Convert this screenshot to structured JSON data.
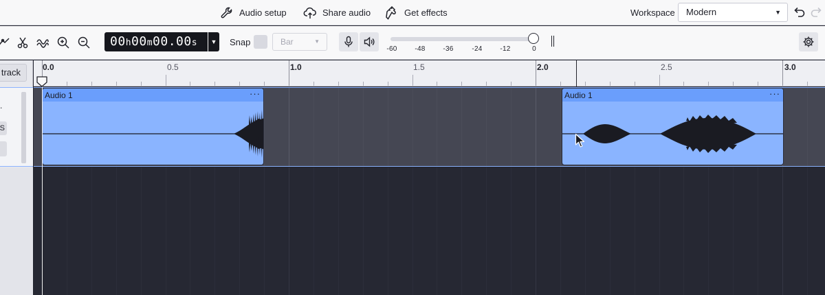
{
  "topbar": {
    "audio_setup": "Audio setup",
    "share_audio": "Share audio",
    "get_effects": "Get effects",
    "workspace_label": "Workspace",
    "workspace_value": "Modern"
  },
  "toolbar": {
    "timecode": {
      "h": "00",
      "hu": "h",
      "m": "00",
      "mu": "m",
      "s": "00.00",
      "su": "s"
    },
    "snap_label": "Snap",
    "snap_value": "Bar",
    "meter_labels": [
      "-60",
      "-48",
      "-36",
      "-24",
      "-12",
      "0"
    ]
  },
  "left_panel": {
    "add_track_label": "track",
    "track_dot": ".",
    "solo_label": "S"
  },
  "ruler": {
    "labels": [
      "0.0",
      "0.5",
      "1.0",
      "1.5",
      "2.0",
      "2.5",
      "3.0"
    ]
  },
  "clips": [
    {
      "name": "Audio 1",
      "menu": "···"
    },
    {
      "name": "Audio 1",
      "menu": "···"
    }
  ],
  "colors": {
    "clip_body": "#8ab4ff",
    "clip_header": "#6a9efc",
    "track_bg": "#454753",
    "empty_bg": "#262833",
    "selection_border": "#8bb3ff"
  }
}
